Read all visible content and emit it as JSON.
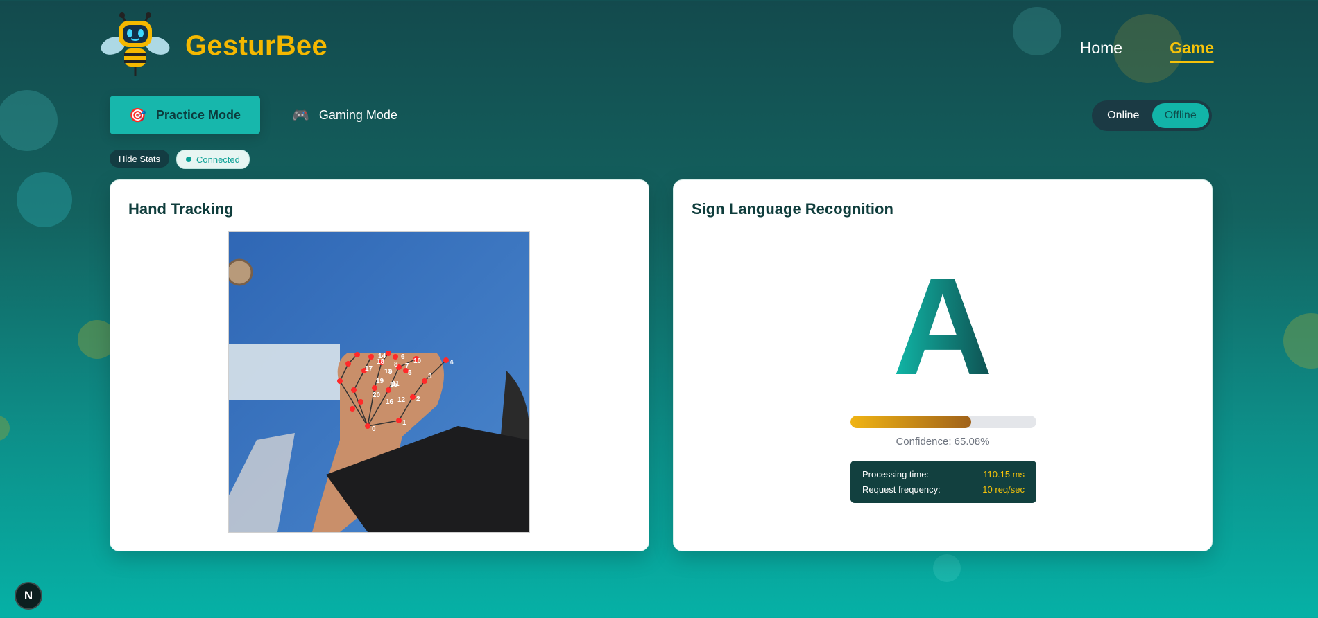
{
  "brand": {
    "name": "GesturBee",
    "logo_icon": "bee-robot-icon"
  },
  "nav": {
    "home": "Home",
    "game": "Game",
    "active": "Game"
  },
  "modes": [
    {
      "label": "Practice Mode",
      "icon": "target-icon",
      "glyph": "🎯",
      "active": true
    },
    {
      "label": "Gaming Mode",
      "icon": "gamepad-icon",
      "glyph": "🎮",
      "active": false
    }
  ],
  "connection_toggle": {
    "online": "Online",
    "offline": "Offline",
    "selected": "Offline"
  },
  "pills": {
    "hide_stats": "Hide Stats",
    "status": "Connected"
  },
  "hand_tracking": {
    "title": "Hand Tracking",
    "landmark_labels": [
      "0",
      "1",
      "2",
      "3",
      "4",
      "5",
      "6",
      "7",
      "8",
      "9",
      "10",
      "11",
      "12",
      "13",
      "14",
      "15",
      "16",
      "17",
      "18",
      "19",
      "20"
    ]
  },
  "recognition": {
    "title": "Sign Language Recognition",
    "letter": "A",
    "confidence_value": 65.08,
    "confidence_text": "Confidence: 65.08%",
    "stats": [
      {
        "label": "Processing time:",
        "value": "110.15 ms"
      },
      {
        "label": "Request frequency:",
        "value": "10 req/sec"
      }
    ]
  },
  "dev_badge": "N",
  "colors": {
    "accent": "#17b7ac",
    "brand_yellow": "#f5b800",
    "card_text": "#0f3d3c",
    "stats_bg": "#12403f"
  }
}
